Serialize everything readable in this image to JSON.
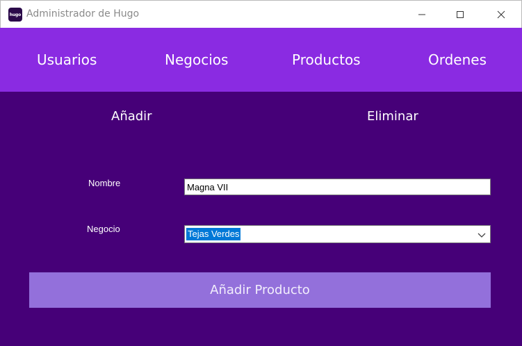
{
  "window": {
    "icon_text": "hugo",
    "title": "Administrador de Hugo"
  },
  "nav": {
    "items": [
      {
        "label": "Usuarios"
      },
      {
        "label": "Negocios"
      },
      {
        "label": "Productos"
      },
      {
        "label": "Ordenes"
      }
    ]
  },
  "subtabs": {
    "add": "Añadir",
    "delete": "Eliminar"
  },
  "form": {
    "nombre_label": "Nombre",
    "nombre_value": "Magna VII",
    "negocio_label": "Negocio",
    "negocio_value": "Tejas Verdes",
    "submit_label": "Añadir Producto"
  },
  "colors": {
    "background": "#460078",
    "navbar": "#8a2be2",
    "button": "#9370db",
    "selection": "#0078d7"
  },
  "icons": {
    "minimize": "minimize-icon",
    "maximize": "maximize-icon",
    "close": "close-icon",
    "dropdown": "chevron-down-icon"
  }
}
